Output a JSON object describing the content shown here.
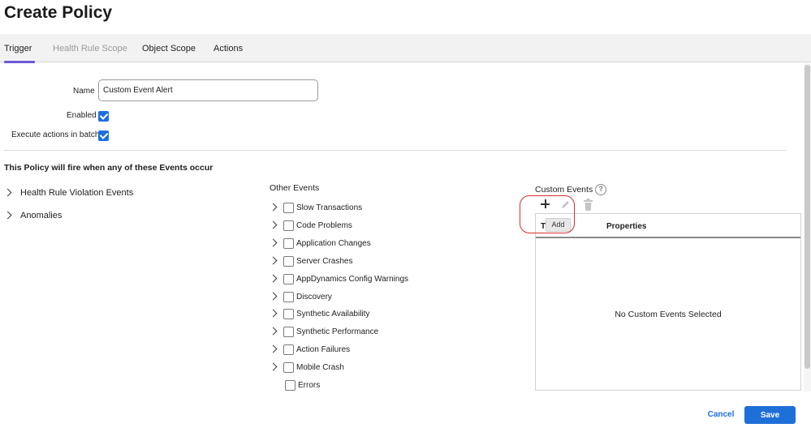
{
  "page": {
    "title": "Create Policy"
  },
  "tabs": [
    {
      "label": "Trigger",
      "active": true
    },
    {
      "label": "Health Rule Scope",
      "disabled": true
    },
    {
      "label": "Object Scope"
    },
    {
      "label": "Actions"
    }
  ],
  "form": {
    "name_label": "Name",
    "name_value": "Custom Event Alert",
    "enabled_label": "Enabled",
    "enabled_checked": true,
    "batch_label": "Execute actions in batch",
    "batch_checked": true
  },
  "trigger_section": {
    "title": "This Policy will fire when any of these Events occur",
    "groups": [
      "Health Rule Violation Events",
      "Anomalies"
    ]
  },
  "other_events": {
    "title": "Other Events",
    "items": [
      {
        "label": "Slow Transactions",
        "expandable": true,
        "checked": false
      },
      {
        "label": "Code Problems",
        "expandable": true,
        "checked": false
      },
      {
        "label": "Application Changes",
        "expandable": true,
        "checked": false
      },
      {
        "label": "Server Crashes",
        "expandable": true,
        "checked": false
      },
      {
        "label": "AppDynamics Config Warnings",
        "expandable": true,
        "checked": false
      },
      {
        "label": "Discovery",
        "expandable": true,
        "checked": false
      },
      {
        "label": "Synthetic Availability",
        "expandable": true,
        "checked": false
      },
      {
        "label": "Synthetic Performance",
        "expandable": true,
        "checked": false
      },
      {
        "label": "Action Failures",
        "expandable": true,
        "checked": false
      },
      {
        "label": "Mobile Crash",
        "expandable": true,
        "checked": false
      },
      {
        "label": "Errors",
        "expandable": false,
        "checked": false
      }
    ]
  },
  "custom_events": {
    "title": "Custom Events",
    "help_glyph": "?",
    "toolbar": {
      "add_icon": "plus-icon",
      "edit_icon": "pencil-icon",
      "delete_icon": "trash-icon"
    },
    "tooltip": "Add",
    "columns": [
      "Ty",
      "Properties"
    ],
    "empty_message": "No Custom Events Selected",
    "highlight_color": "#d62e2e"
  },
  "footer": {
    "cancel_label": "Cancel",
    "save_label": "Save"
  },
  "colors": {
    "accent": "#1f6fd8",
    "tab_indicator": "#6d58d6",
    "checkbox": "#1d6fe0"
  }
}
